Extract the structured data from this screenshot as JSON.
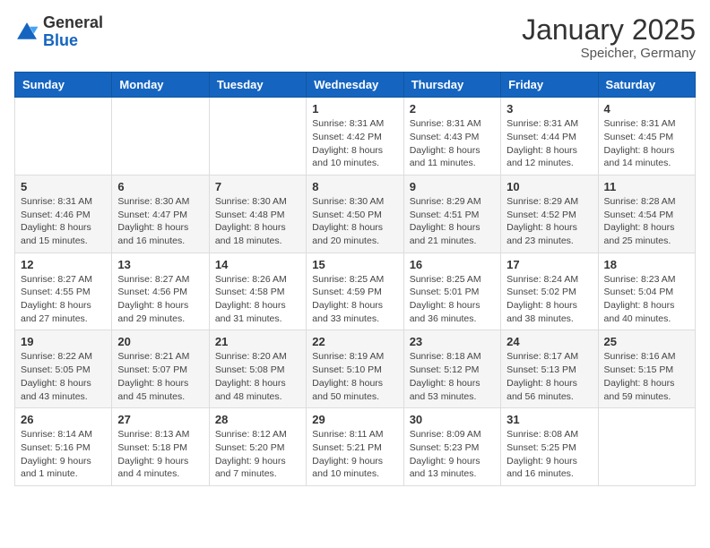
{
  "logo": {
    "general": "General",
    "blue": "Blue"
  },
  "header": {
    "month": "January 2025",
    "location": "Speicher, Germany"
  },
  "days_of_week": [
    "Sunday",
    "Monday",
    "Tuesday",
    "Wednesday",
    "Thursday",
    "Friday",
    "Saturday"
  ],
  "weeks": [
    [
      {
        "day": "",
        "info": ""
      },
      {
        "day": "",
        "info": ""
      },
      {
        "day": "",
        "info": ""
      },
      {
        "day": "1",
        "info": "Sunrise: 8:31 AM\nSunset: 4:42 PM\nDaylight: 8 hours\nand 10 minutes."
      },
      {
        "day": "2",
        "info": "Sunrise: 8:31 AM\nSunset: 4:43 PM\nDaylight: 8 hours\nand 11 minutes."
      },
      {
        "day": "3",
        "info": "Sunrise: 8:31 AM\nSunset: 4:44 PM\nDaylight: 8 hours\nand 12 minutes."
      },
      {
        "day": "4",
        "info": "Sunrise: 8:31 AM\nSunset: 4:45 PM\nDaylight: 8 hours\nand 14 minutes."
      }
    ],
    [
      {
        "day": "5",
        "info": "Sunrise: 8:31 AM\nSunset: 4:46 PM\nDaylight: 8 hours\nand 15 minutes."
      },
      {
        "day": "6",
        "info": "Sunrise: 8:30 AM\nSunset: 4:47 PM\nDaylight: 8 hours\nand 16 minutes."
      },
      {
        "day": "7",
        "info": "Sunrise: 8:30 AM\nSunset: 4:48 PM\nDaylight: 8 hours\nand 18 minutes."
      },
      {
        "day": "8",
        "info": "Sunrise: 8:30 AM\nSunset: 4:50 PM\nDaylight: 8 hours\nand 20 minutes."
      },
      {
        "day": "9",
        "info": "Sunrise: 8:29 AM\nSunset: 4:51 PM\nDaylight: 8 hours\nand 21 minutes."
      },
      {
        "day": "10",
        "info": "Sunrise: 8:29 AM\nSunset: 4:52 PM\nDaylight: 8 hours\nand 23 minutes."
      },
      {
        "day": "11",
        "info": "Sunrise: 8:28 AM\nSunset: 4:54 PM\nDaylight: 8 hours\nand 25 minutes."
      }
    ],
    [
      {
        "day": "12",
        "info": "Sunrise: 8:27 AM\nSunset: 4:55 PM\nDaylight: 8 hours\nand 27 minutes."
      },
      {
        "day": "13",
        "info": "Sunrise: 8:27 AM\nSunset: 4:56 PM\nDaylight: 8 hours\nand 29 minutes."
      },
      {
        "day": "14",
        "info": "Sunrise: 8:26 AM\nSunset: 4:58 PM\nDaylight: 8 hours\nand 31 minutes."
      },
      {
        "day": "15",
        "info": "Sunrise: 8:25 AM\nSunset: 4:59 PM\nDaylight: 8 hours\nand 33 minutes."
      },
      {
        "day": "16",
        "info": "Sunrise: 8:25 AM\nSunset: 5:01 PM\nDaylight: 8 hours\nand 36 minutes."
      },
      {
        "day": "17",
        "info": "Sunrise: 8:24 AM\nSunset: 5:02 PM\nDaylight: 8 hours\nand 38 minutes."
      },
      {
        "day": "18",
        "info": "Sunrise: 8:23 AM\nSunset: 5:04 PM\nDaylight: 8 hours\nand 40 minutes."
      }
    ],
    [
      {
        "day": "19",
        "info": "Sunrise: 8:22 AM\nSunset: 5:05 PM\nDaylight: 8 hours\nand 43 minutes."
      },
      {
        "day": "20",
        "info": "Sunrise: 8:21 AM\nSunset: 5:07 PM\nDaylight: 8 hours\nand 45 minutes."
      },
      {
        "day": "21",
        "info": "Sunrise: 8:20 AM\nSunset: 5:08 PM\nDaylight: 8 hours\nand 48 minutes."
      },
      {
        "day": "22",
        "info": "Sunrise: 8:19 AM\nSunset: 5:10 PM\nDaylight: 8 hours\nand 50 minutes."
      },
      {
        "day": "23",
        "info": "Sunrise: 8:18 AM\nSunset: 5:12 PM\nDaylight: 8 hours\nand 53 minutes."
      },
      {
        "day": "24",
        "info": "Sunrise: 8:17 AM\nSunset: 5:13 PM\nDaylight: 8 hours\nand 56 minutes."
      },
      {
        "day": "25",
        "info": "Sunrise: 8:16 AM\nSunset: 5:15 PM\nDaylight: 8 hours\nand 59 minutes."
      }
    ],
    [
      {
        "day": "26",
        "info": "Sunrise: 8:14 AM\nSunset: 5:16 PM\nDaylight: 9 hours\nand 1 minute."
      },
      {
        "day": "27",
        "info": "Sunrise: 8:13 AM\nSunset: 5:18 PM\nDaylight: 9 hours\nand 4 minutes."
      },
      {
        "day": "28",
        "info": "Sunrise: 8:12 AM\nSunset: 5:20 PM\nDaylight: 9 hours\nand 7 minutes."
      },
      {
        "day": "29",
        "info": "Sunrise: 8:11 AM\nSunset: 5:21 PM\nDaylight: 9 hours\nand 10 minutes."
      },
      {
        "day": "30",
        "info": "Sunrise: 8:09 AM\nSunset: 5:23 PM\nDaylight: 9 hours\nand 13 minutes."
      },
      {
        "day": "31",
        "info": "Sunrise: 8:08 AM\nSunset: 5:25 PM\nDaylight: 9 hours\nand 16 minutes."
      },
      {
        "day": "",
        "info": ""
      }
    ]
  ]
}
